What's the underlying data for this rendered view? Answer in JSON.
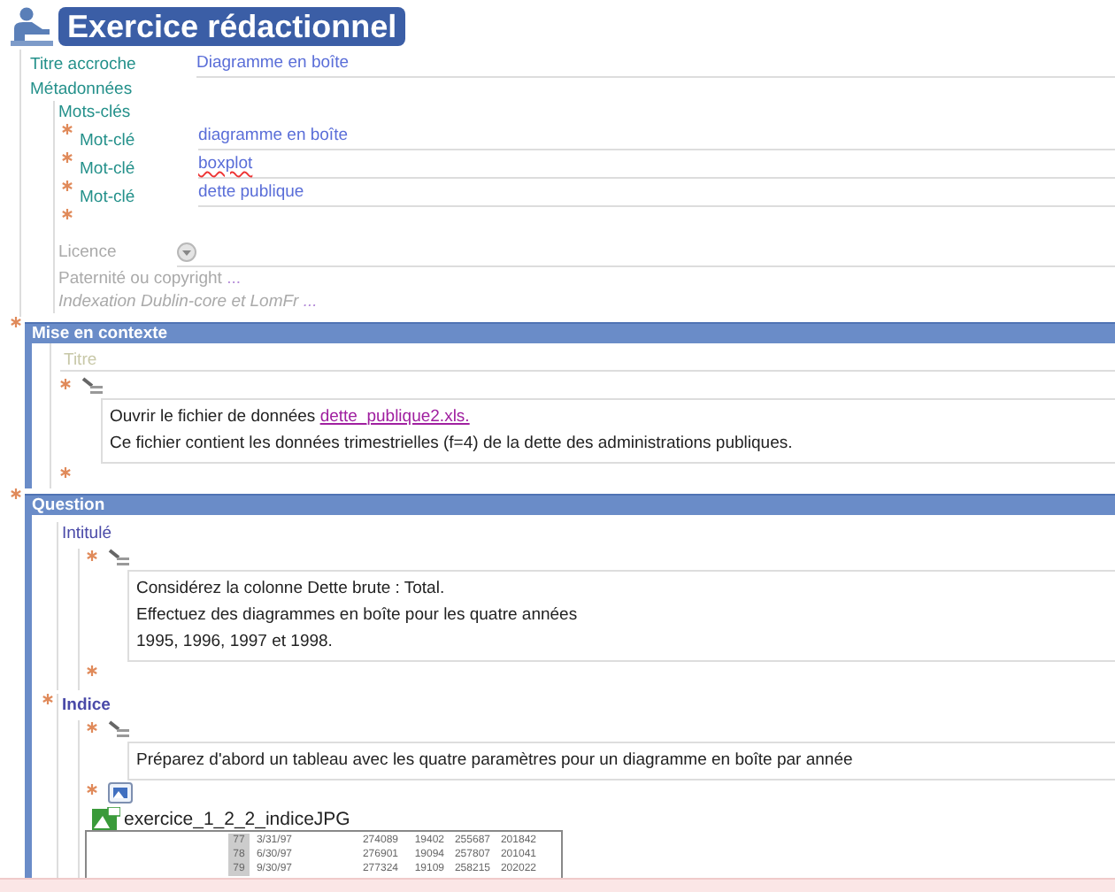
{
  "title": "Exercice rédactionnel",
  "hook": {
    "label": "Titre accroche",
    "value": "Diagramme en boîte"
  },
  "metadata": {
    "label": "Métadonnées",
    "keywords_label": "Mots-clés",
    "keywords": [
      {
        "label": "Mot-clé",
        "value": "diagramme en boîte",
        "misspelled": false
      },
      {
        "label": "Mot-clé",
        "value": "boxplot",
        "misspelled": true
      },
      {
        "label": "Mot-clé",
        "value": "dette publique",
        "misspelled": false
      }
    ],
    "licence": {
      "label": "Licence",
      "disabled": true
    },
    "links": [
      {
        "label": "Paternité ou copyright",
        "more": "...",
        "italic": false
      },
      {
        "label": "Indexation Dublin-core et LomFr",
        "more": "...",
        "italic": true
      }
    ]
  },
  "sections": [
    {
      "title": "Mise en contexte",
      "title_placeholder": "Titre",
      "blocks": [
        {
          "kind": "text",
          "paragraphs": [
            "Ouvrir le fichier de données ",
            "Ce fichier contient les données trimestrielles (f=4) de la dette des administrations publiques."
          ],
          "link": "dette_publique2.xls."
        }
      ]
    },
    {
      "title": "Question",
      "subsections": [
        {
          "label": "Intitulé",
          "blocks": [
            {
              "kind": "text",
              "paragraphs": [
                "Considérez la colonne Dette brute : Total.",
                "Effectuez des diagrammes en boîte pour les quatre années",
                "1995, 1996, 1997 et 1998."
              ]
            }
          ]
        },
        {
          "label": "Indice",
          "blocks": [
            {
              "kind": "text",
              "paragraphs": [
                "Préparez d'abord un tableau avec les quatre paramètres pour un diagramme en boîte par année"
              ]
            },
            {
              "kind": "image",
              "filename": "exercice_1_2_2_indiceJPG",
              "rows": [
                [
                  "77",
                  "3/31/97",
                  "274089",
                  "19402",
                  "255687",
                  "201842"
                ],
                [
                  "78",
                  "6/30/97",
                  "276901",
                  "19094",
                  "257807",
                  "201041"
                ],
                [
                  "79",
                  "9/30/97",
                  "277324",
                  "19109",
                  "258215",
                  "202022"
                ]
              ]
            }
          ]
        }
      ]
    }
  ]
}
